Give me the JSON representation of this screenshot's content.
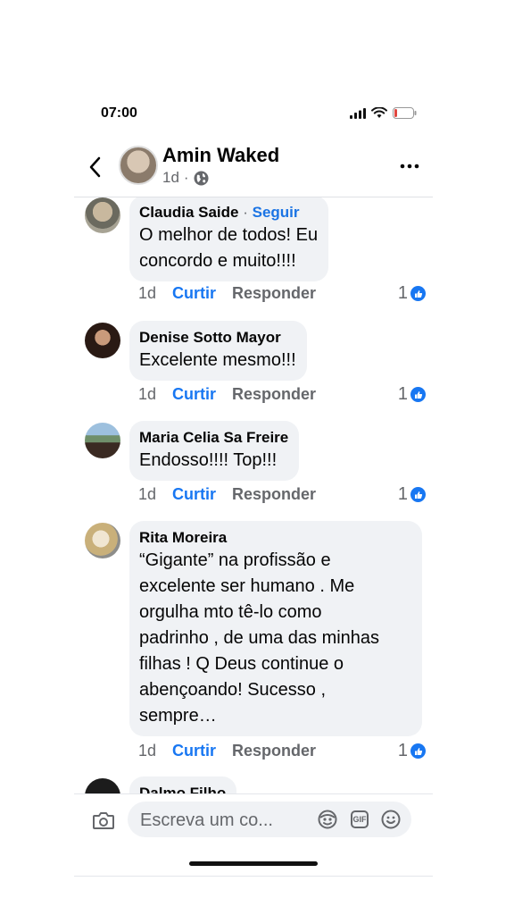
{
  "status_bar": {
    "time": "07:00",
    "icons": [
      "signal-icon",
      "wifi-icon",
      "battery-icon"
    ]
  },
  "header": {
    "back_icon": "chevron-left-icon",
    "name": "Amin Waked",
    "time": "1d",
    "separator": "·",
    "privacy_icon": "globe-icon",
    "more_icon": "more-horizontal-icon"
  },
  "comments": [
    {
      "name": "Claudia Saide",
      "separator": "·",
      "follow_label": "Seguir",
      "lines": [
        "O melhor de todos! Eu",
        "concordo e muito!!!!"
      ],
      "time": "1d",
      "like_label": "Curtir",
      "reply_label": "Responder",
      "reaction_count": "1"
    },
    {
      "name": "Denise Sotto Mayor",
      "lines": [
        "Excelente mesmo!!!"
      ],
      "time": "1d",
      "like_label": "Curtir",
      "reply_label": "Responder",
      "reaction_count": "1"
    },
    {
      "name": "Maria Celia Sa Freire",
      "lines": [
        "Endosso!!!!  Top!!!"
      ],
      "time": "1d",
      "like_label": "Curtir",
      "reply_label": "Responder",
      "reaction_count": "1"
    },
    {
      "name": "Rita Moreira",
      "lines": [
        "“Gigante” na profissão e",
        "excelente ser humano . Me",
        "orgulha mto tê-lo como",
        "padrinho , de uma das minhas",
        "filhas ! Q Deus continue o",
        "abençoando! Sucesso ,",
        "sempre…"
      ],
      "time": "1d",
      "like_label": "Curtir",
      "reply_label": "Responder",
      "reaction_count": "1"
    },
    {
      "name": "Dalmo Filho"
    }
  ],
  "composer": {
    "camera_icon": "camera-icon",
    "placeholder": "Escreva um co...",
    "icons": [
      "avatar-sticker-icon",
      "gif-icon",
      "emoji-icon"
    ],
    "gif_label": "GIF"
  },
  "colors": {
    "accent": "#1877f2",
    "bubble": "#f0f2f5",
    "secondary_text": "#65676b"
  }
}
